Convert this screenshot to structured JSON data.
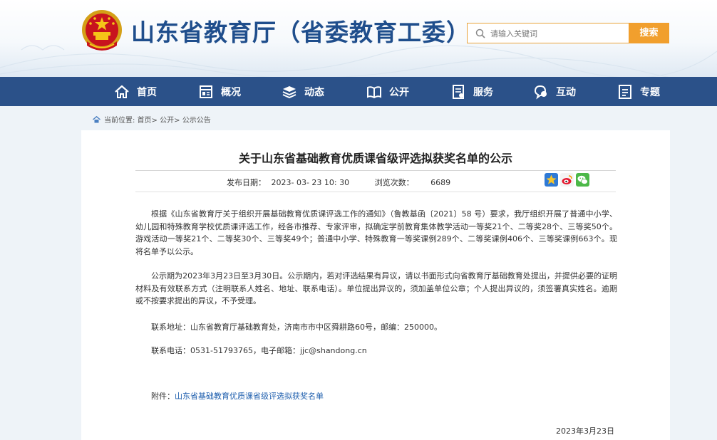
{
  "header": {
    "site_title": "山东省教育厅（省委教育工委）",
    "search_placeholder": "请输入关键词",
    "search_button": "搜索"
  },
  "nav": {
    "items": [
      {
        "label": "首页",
        "icon": "home-icon"
      },
      {
        "label": "概况",
        "icon": "overview-icon"
      },
      {
        "label": "动态",
        "icon": "news-stack-icon"
      },
      {
        "label": "公开",
        "icon": "open-book-icon"
      },
      {
        "label": "服务",
        "icon": "service-doc-icon"
      },
      {
        "label": "互动",
        "icon": "chat-icon"
      },
      {
        "label": "专题",
        "icon": "topic-doc-icon"
      }
    ]
  },
  "breadcrumb": {
    "prefix": "当前位置:",
    "items": [
      "首页>",
      "公开>",
      "公示公告"
    ]
  },
  "article": {
    "title": "关于山东省基础教育优质课省级评选拟获奖名单的公示",
    "publish_label": "发布日期：",
    "publish_date": "2023- 03- 23 10: 30",
    "views_label": "浏览次数：",
    "views": "6689",
    "share_icons": [
      "qzone-star-icon",
      "weibo-icon",
      "wechat-icon"
    ],
    "paragraph1": "根据《山东省教育厅关于组织开展基础教育优质课评选工作的通知》（鲁教基函〔2021〕58 号）要求，我厅组织开展了普通中小学、幼儿园和特殊教育学校优质课评选工作，经各市推荐、专家评审，拟确定学前教育集体教学活动一等奖21个、二等奖28个、三等奖50个。游戏活动一等奖21个、二等奖30个、三等奖49个；普通中小学、特殊教育一等奖课例289个、二等奖课例406个、三等奖课例663个。现将名单予以公示。",
    "paragraph2": "公示期为2023年3月23日至3月30日。公示期内，若对评选结果有异议，请以书面形式向省教育厅基础教育处提出，并提供必要的证明材料及有效联系方式（注明联系人姓名、地址、联系电话）。单位提出异议的，须加盖单位公章；个人提出异议的，须签署真实姓名。逾期或不按要求提出的异议，不予受理。",
    "address": "联系地址：山东省教育厅基础教育处，济南市市中区舜耕路60号，邮编：250000。",
    "phone": "联系电话：0531-51793765，电子邮箱：jjc@shandong.cn",
    "attachment_label": "附件：",
    "attachment_link": "山东省基础教育优质课省级评选拟获奖名单",
    "sign_date": "2023年3月23日"
  },
  "colors": {
    "nav_bg": "#2b5189",
    "title_blue": "#1f4e8c",
    "search_orange": "#f19f2d",
    "link_blue": "#1f5fae"
  }
}
